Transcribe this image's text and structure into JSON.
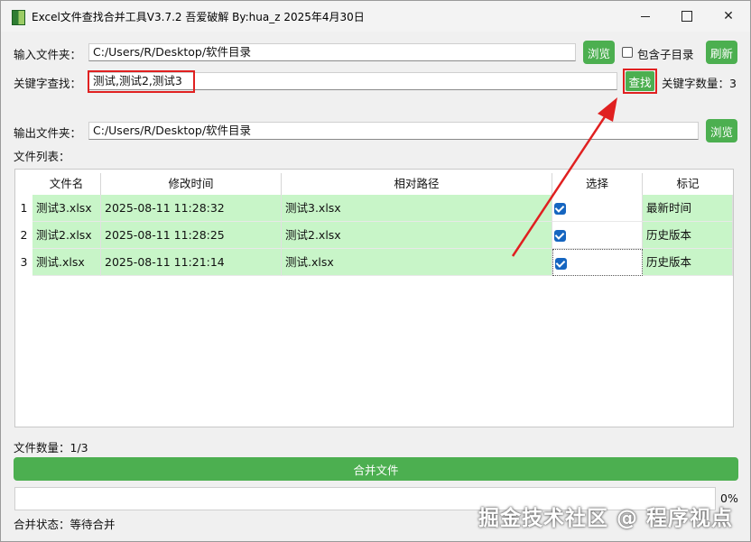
{
  "window": {
    "title": "Excel文件查找合并工具V3.7.2 吾爱破解 By:hua_z 2025年4月30日",
    "min_symbol": "—",
    "max_symbol": "☐",
    "close_symbol": "✕"
  },
  "input_folder": {
    "label": "输入文件夹：",
    "value": "C:/Users/R/Desktop/软件目录",
    "browse_label": "浏览"
  },
  "subfolder": {
    "label": "包含子目录",
    "checked": false
  },
  "refresh_label": "刷新",
  "keyword": {
    "label": "关键字查找：",
    "value": "测试,测试2,测试3",
    "search_label": "查找",
    "count_label": "关键字数量：",
    "count": "3"
  },
  "output_folder": {
    "label": "输出文件夹：",
    "value": "C:/Users/R/Desktop/软件目录",
    "browse_label": "浏览"
  },
  "file_list_label": "文件列表：",
  "table": {
    "columns": [
      "文件名",
      "修改时间",
      "相对路径",
      "选择",
      "标记"
    ],
    "rows": [
      {
        "index": "1",
        "name": "测试3.xlsx",
        "time": "2025-08-11 11:28:32",
        "path": "测试3.xlsx",
        "selected": true,
        "mark": "最新时间"
      },
      {
        "index": "2",
        "name": "测试2.xlsx",
        "time": "2025-08-11 11:28:25",
        "path": "测试2.xlsx",
        "selected": true,
        "mark": "历史版本"
      },
      {
        "index": "3",
        "name": "测试.xlsx",
        "time": "2025-08-11 11:21:14",
        "path": "测试.xlsx",
        "selected": true,
        "mark": "历史版本"
      }
    ],
    "row_bg": "#c8f5c8"
  },
  "file_count": "文件数量：1/3",
  "merge_label": "合并文件",
  "progress": {
    "value": 0,
    "text": "0%"
  },
  "status": "合并状态：等待合并",
  "watermark": "掘金技术社区 @ 程序视点",
  "colors": {
    "accent": "#4caf50",
    "highlight": "#e02020",
    "checkbox": "#1565c0"
  }
}
